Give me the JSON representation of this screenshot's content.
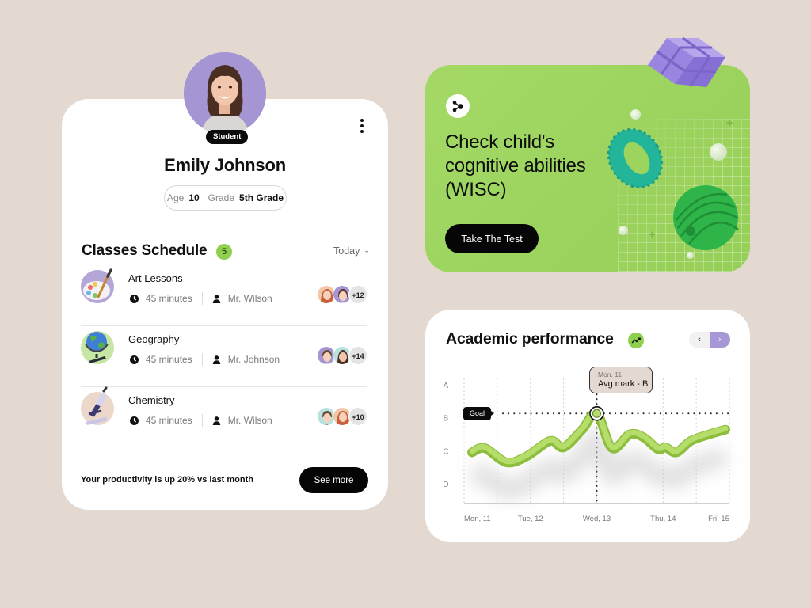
{
  "profile": {
    "role_badge": "Student",
    "name": "Emily Johnson",
    "age_label": "Age",
    "age_value": "10",
    "grade_label": "Grade",
    "grade_value": "5th Grade",
    "menu_icon": "more-vertical-icon",
    "avatar_bg": "#a695d3"
  },
  "schedule": {
    "title": "Classes Schedule",
    "count": "5",
    "filter": "Today",
    "classes": [
      {
        "name": "Art Lessons",
        "icon": "palette-icon",
        "icon_bg": "#b4a7d8",
        "duration": "45 minutes",
        "teacher": "Mr. Wilson",
        "extra_students": "+12"
      },
      {
        "name": "Geography",
        "icon": "globe-icon",
        "icon_bg": "#c6e6a3",
        "duration": "45 minutes",
        "teacher": "Mr. Johnson",
        "extra_students": "+14"
      },
      {
        "name": "Chemistry",
        "icon": "microscope-icon",
        "icon_bg": "#ecd8cb",
        "duration": "45 minutes",
        "teacher": "Mr. Wilson",
        "extra_students": "+10"
      }
    ],
    "productivity_text": "Your productivity is up 20% vs last month",
    "see_more_label": "See more"
  },
  "promo": {
    "title_lines": [
      "Check child's",
      "cognitive abilities",
      "(WISC)"
    ],
    "title": "Check child's cognitive abilities (WISC)",
    "cta_label": "Take The Test",
    "share_icon": "share-icon",
    "bg_color": "#a0d662"
  },
  "performance": {
    "title": "Academic performance",
    "trend_icon": "trending-up-icon",
    "prev_label": "‹",
    "next_label": "›",
    "tooltip": {
      "date": "Mon. 11",
      "value": "Avg mark - B"
    },
    "goal_label": "Goal"
  },
  "chart_data": {
    "type": "line",
    "title": "Academic performance",
    "xlabel": "",
    "ylabel": "",
    "x_ticks": [
      "Mon, 11",
      "Tue, 12",
      "Wed, 13",
      "Thu, 14",
      "Fri, 15"
    ],
    "y_ticks": [
      "A",
      "B",
      "C",
      "D"
    ],
    "y_tick_values": [
      4,
      3,
      2,
      1
    ],
    "ylim": [
      0.4,
      4
    ],
    "xlim": [
      0,
      4
    ],
    "grid": "vertical-dashed",
    "goal": {
      "label": "Goal",
      "value": 3.13
    },
    "highlight": {
      "x": 2.0,
      "y": 3.13,
      "label": "Avg mark - B",
      "date": "Mon. 11"
    },
    "series": [
      {
        "name": "Average mark",
        "color": "#9ccc4a",
        "points": [
          [
            0.12,
            1.95
          ],
          [
            0.31,
            2.08
          ],
          [
            0.64,
            1.65
          ],
          [
            0.94,
            1.83
          ],
          [
            1.3,
            2.3
          ],
          [
            1.5,
            2.1
          ],
          [
            1.78,
            2.64
          ],
          [
            2.0,
            3.13
          ],
          [
            2.23,
            2.08
          ],
          [
            2.5,
            2.5
          ],
          [
            2.71,
            2.4
          ],
          [
            2.92,
            2.05
          ],
          [
            3.04,
            2.1
          ],
          [
            3.2,
            1.95
          ],
          [
            3.42,
            2.3
          ],
          [
            3.7,
            2.5
          ],
          [
            3.94,
            2.64
          ]
        ]
      }
    ]
  }
}
